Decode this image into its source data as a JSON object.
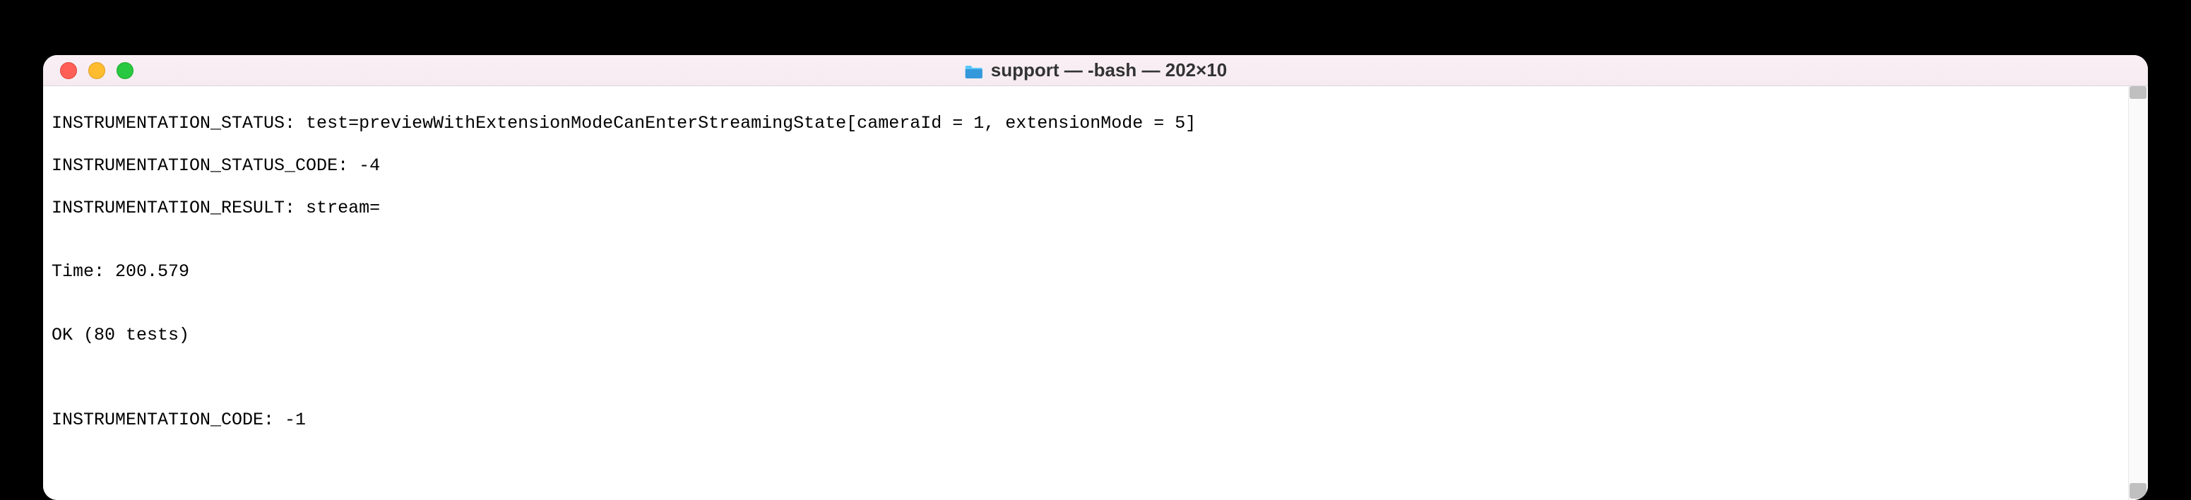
{
  "window": {
    "title": "support — -bash — 202×10",
    "folder_icon": "folder"
  },
  "terminal": {
    "lines": [
      "INSTRUMENTATION_STATUS: test=previewWithExtensionModeCanEnterStreamingState[cameraId = 1, extensionMode = 5]",
      "INSTRUMENTATION_STATUS_CODE: -4",
      "INSTRUMENTATION_RESULT: stream=",
      "",
      "Time: 200.579",
      "",
      "OK (80 tests)",
      "",
      "",
      "INSTRUMENTATION_CODE: -1"
    ]
  }
}
